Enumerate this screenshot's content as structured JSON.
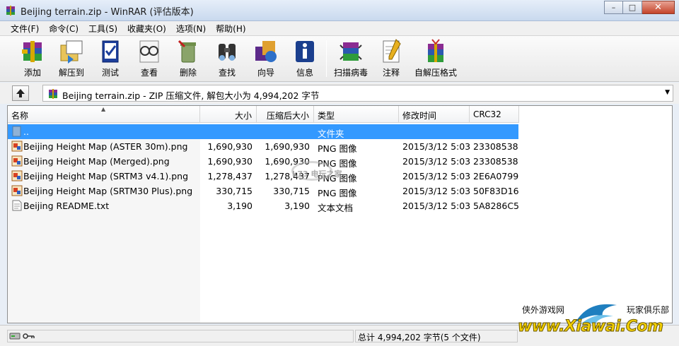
{
  "window": {
    "title": "Beijing terrain.zip - WinRAR (评估版本)",
    "controls": {
      "minimize": "–",
      "maximize": "□",
      "close": "✕"
    }
  },
  "menu": [
    "文件(F)",
    "命令(C)",
    "工具(S)",
    "收藏夹(O)",
    "选项(N)",
    "帮助(H)"
  ],
  "toolbar": [
    {
      "label": "添加",
      "icon": "add-archive-icon"
    },
    {
      "label": "解压到",
      "icon": "extract-to-icon"
    },
    {
      "label": "测试",
      "icon": "test-icon"
    },
    {
      "label": "查看",
      "icon": "view-icon"
    },
    {
      "label": "删除",
      "icon": "delete-icon"
    },
    {
      "label": "查找",
      "icon": "find-icon"
    },
    {
      "label": "向导",
      "icon": "wizard-icon"
    },
    {
      "label": "信息",
      "icon": "info-icon"
    },
    {
      "label": "扫描病毒",
      "icon": "virus-scan-icon"
    },
    {
      "label": "注释",
      "icon": "comment-icon"
    },
    {
      "label": "自解压格式",
      "icon": "sfx-icon"
    }
  ],
  "address": {
    "text": "Beijing terrain.zip - ZIP 压缩文件, 解包大小为 4,994,202 字节",
    "dropdown": "▼"
  },
  "columns": [
    "名称",
    "大小",
    "压缩后大小",
    "类型",
    "修改时间",
    "CRC32"
  ],
  "parent_row": {
    "name": "..",
    "type": "文件夹"
  },
  "files": [
    {
      "name": "Beijing Height Map (ASTER 30m).png",
      "size": "1,690,930",
      "packed": "1,690,930",
      "type": "PNG 图像",
      "modified": "2015/3/12 5:03",
      "crc": "23308538",
      "icon": "png-file-icon"
    },
    {
      "name": "Beijing Height Map (Merged).png",
      "size": "1,690,930",
      "packed": "1,690,930",
      "type": "PNG 图像",
      "modified": "2015/3/12 5:03",
      "crc": "23308538",
      "icon": "png-file-icon"
    },
    {
      "name": "Beijing Height Map (SRTM3 v4.1).png",
      "size": "1,278,437",
      "packed": "1,278,437",
      "type": "PNG 图像",
      "modified": "2015/3/12 5:03",
      "crc": "2E6A0799",
      "icon": "png-file-icon"
    },
    {
      "name": "Beijing Height Map (SRTM30 Plus).png",
      "size": "330,715",
      "packed": "330,715",
      "type": "PNG 图像",
      "modified": "2015/3/12 5:03",
      "crc": "50F83D16",
      "icon": "png-file-icon"
    },
    {
      "name": "Beijing README.txt",
      "size": "3,190",
      "packed": "3,190",
      "type": "文本文档",
      "modified": "2015/3/12 5:03",
      "crc": "5A8286C5",
      "icon": "text-file-icon"
    }
  ],
  "watermark": "k73 电玩之家",
  "status": {
    "summary": "总计 4,994,202 字节(5 个文件)"
  },
  "brand": {
    "left_text": "侠外游戏网",
    "right_text": "玩家俱乐部",
    "url": "www.Xiawai.Com"
  },
  "colors": {
    "selection": "#3399ff",
    "brand_yellow": "#f4d000",
    "titlebar": "#c9d9ee"
  }
}
